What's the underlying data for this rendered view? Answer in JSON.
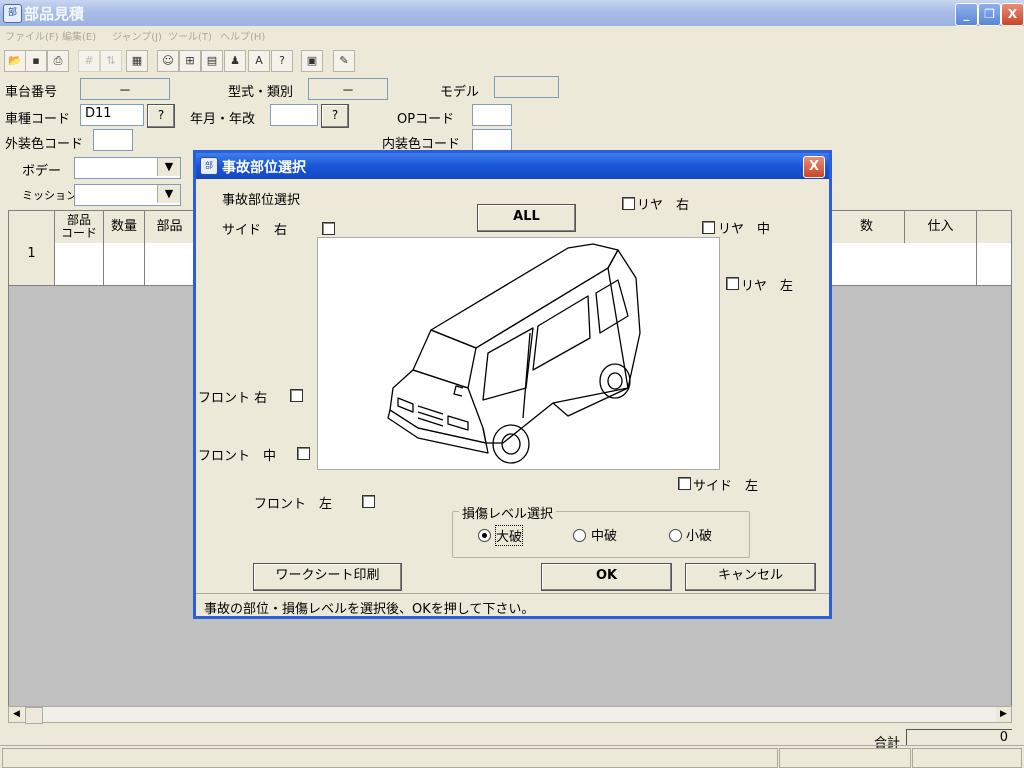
{
  "window": {
    "title": "部品見積",
    "min": "_",
    "max": "❐",
    "close": "X"
  },
  "menu": [
    "ファイル(F)",
    "編集(E)",
    "ジャンプ(J)",
    "ツール(T)",
    "ヘルプ(H)"
  ],
  "form": {
    "chassis_label": "車台番号",
    "chassis_value": "－",
    "model_type_label": "型式・類別",
    "model_type_value": "－",
    "model_label": "モデル",
    "vehicle_code_label": "車種コード",
    "vehicle_code_value": "D11",
    "help_btn": "?",
    "year_label": "年月・年改",
    "op_code_label": "OPコード",
    "ext_color_label": "外装色コード",
    "int_color_label": "内装色コード",
    "body_label": "ボデー",
    "mission_label": "ミッション"
  },
  "grid": {
    "headers": [
      "部品\nコード",
      "数量",
      "部品",
      "数",
      "仕入"
    ],
    "row_num": "1"
  },
  "footer": {
    "total_label": "合計",
    "total_value": "0"
  },
  "dialog": {
    "title": "事故部位選択",
    "section_label": "事故部位選択",
    "all_button": "ALL",
    "side_right": "サイド　右",
    "rear_right": "リヤ　右",
    "rear_center": "リヤ　中",
    "rear_left": "リヤ　左",
    "front_right": "フロント 右",
    "front_center": "フロント　中",
    "front_left": "フロント　左",
    "side_left": "サイド　左",
    "damage_group": "損傷レベル選択",
    "damage_options": [
      "大破",
      "中破",
      "小破"
    ],
    "selected_damage": "大破",
    "worksheet_button": "ワークシート印刷",
    "ok_button": "OK",
    "cancel_button": "キャンセル",
    "status": "事故の部位・損傷レベルを選択後、OKを押して下さい。",
    "close": "X"
  }
}
